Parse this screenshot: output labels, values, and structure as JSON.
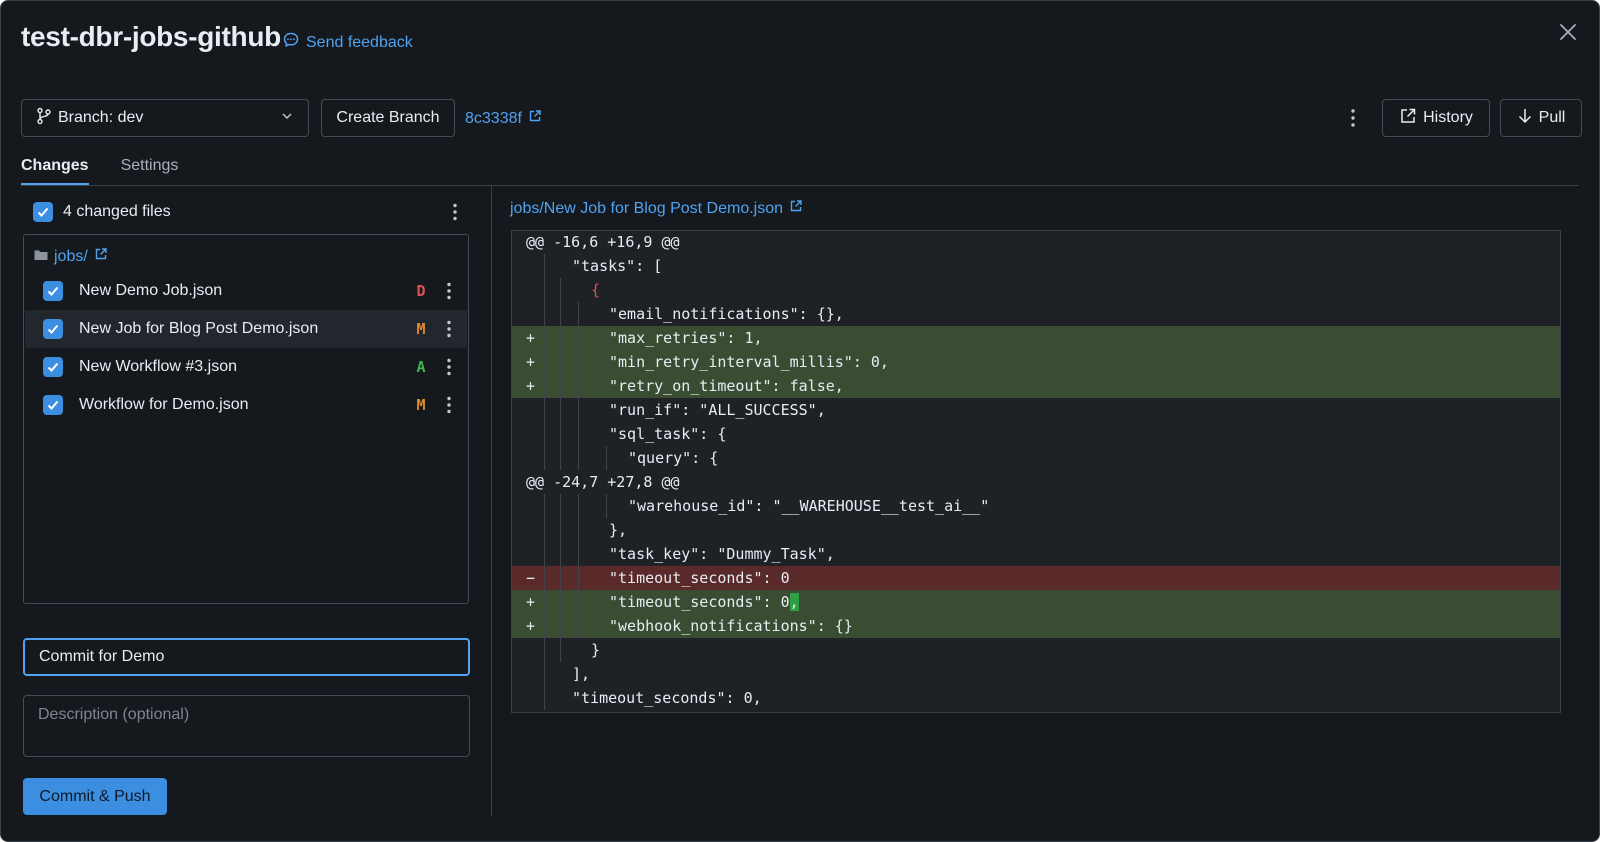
{
  "header": {
    "title": "test-dbr-jobs-github",
    "feedback_label": "Send feedback"
  },
  "toolbar": {
    "branch_label": "Branch: dev",
    "create_branch_label": "Create Branch",
    "commit_hash": "8c3338f",
    "history_label": "History",
    "pull_label": "Pull"
  },
  "tabs": [
    {
      "label": "Changes",
      "active": true
    },
    {
      "label": "Settings",
      "active": false
    }
  ],
  "changes": {
    "summary": "4 changed files",
    "folder": "jobs/",
    "files": [
      {
        "name": "New Demo Job.json",
        "status": "D",
        "status_color": "#e05252",
        "selected": false
      },
      {
        "name": "New Job for Blog Post Demo.json",
        "status": "M",
        "status_color": "#e08a2e",
        "selected": true
      },
      {
        "name": "New Workflow #3.json",
        "status": "A",
        "status_color": "#3fb950",
        "selected": false
      },
      {
        "name": "Workflow for Demo.json",
        "status": "M",
        "status_color": "#e08a2e",
        "selected": false
      }
    ]
  },
  "commit": {
    "message_value": "Commit for Demo",
    "description_placeholder": "Description (optional)",
    "button_label": "Commit & Push"
  },
  "diff": {
    "path": "jobs/New Job for Blog Post Demo.json",
    "lines": [
      {
        "type": "hunk",
        "indent": 0,
        "text": "@@ -16,6 +16,9 @@"
      },
      {
        "type": "ctx",
        "indent": 2,
        "text": "\"tasks\": ["
      },
      {
        "type": "ctx",
        "indent": 3,
        "text": "{"
      },
      {
        "type": "ctx",
        "indent": 4,
        "text": "\"email_notifications\": {},"
      },
      {
        "type": "add",
        "indent": 4,
        "text": "\"max_retries\": 1,"
      },
      {
        "type": "add",
        "indent": 4,
        "text": "\"min_retry_interval_millis\": 0,"
      },
      {
        "type": "add",
        "indent": 4,
        "text": "\"retry_on_timeout\": false,"
      },
      {
        "type": "ctx",
        "indent": 4,
        "text": "\"run_if\": \"ALL_SUCCESS\","
      },
      {
        "type": "ctx",
        "indent": 4,
        "text": "\"sql_task\": {"
      },
      {
        "type": "ctx",
        "indent": 5,
        "text": "\"query\": {"
      },
      {
        "type": "hunk",
        "indent": 0,
        "text": "@@ -24,7 +27,8 @@"
      },
      {
        "type": "ctx",
        "indent": 5,
        "text": "\"warehouse_id\": \"__WAREHOUSE__test_ai__\""
      },
      {
        "type": "ctx",
        "indent": 4,
        "text": "},"
      },
      {
        "type": "ctx",
        "indent": 4,
        "text": "\"task_key\": \"Dummy_Task\","
      },
      {
        "type": "del",
        "indent": 4,
        "text": "\"timeout_seconds\": 0"
      },
      {
        "type": "add",
        "indent": 4,
        "text": "\"timeout_seconds\": 0",
        "hl": ","
      },
      {
        "type": "add",
        "indent": 4,
        "text": "\"webhook_notifications\": {}"
      },
      {
        "type": "ctx",
        "indent": 3,
        "text": "}"
      },
      {
        "type": "ctx",
        "indent": 2,
        "text": "],"
      },
      {
        "type": "ctx",
        "indent": 2,
        "text": "\"timeout_seconds\": 0,"
      }
    ]
  }
}
